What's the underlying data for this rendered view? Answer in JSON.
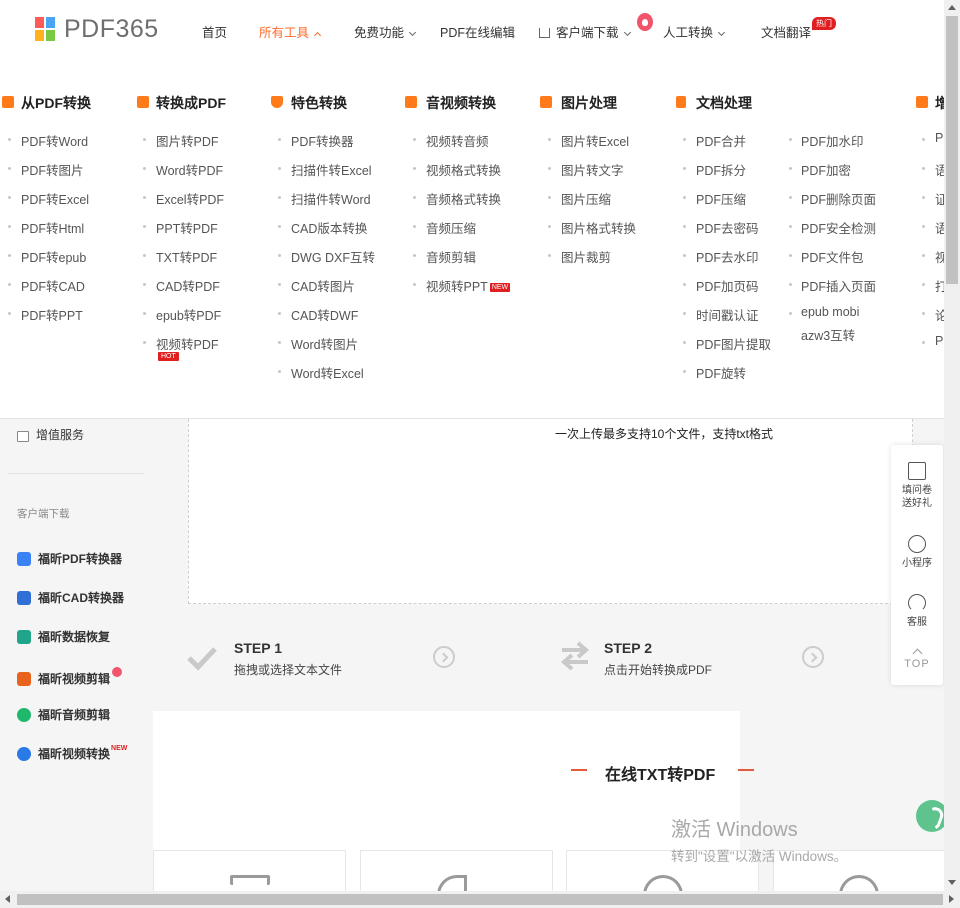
{
  "header": {
    "logo_text": "PDF365",
    "nav": [
      {
        "label": "首页"
      },
      {
        "label": "所有工具"
      },
      {
        "label": "免费功能"
      },
      {
        "label": "PDF在线编辑"
      },
      {
        "label": "客户端下载"
      },
      {
        "label": "人工转换"
      },
      {
        "label": "文档翻译"
      }
    ],
    "badge": "热门"
  },
  "mega_menu": {
    "columns": [
      {
        "title": "从PDF转换",
        "icon": "convert-from-pdf-icon",
        "items": [
          "PDF转Word",
          "PDF转图片",
          "PDF转Excel",
          "PDF转Html",
          "PDF转epub",
          "PDF转CAD",
          "PDF转PPT"
        ]
      },
      {
        "title": "转换成PDF",
        "icon": "convert-to-pdf-icon",
        "items": [
          "图片转PDF",
          "Word转PDF",
          "Excel转PDF",
          "PPT转PDF",
          "TXT转PDF",
          "CAD转PDF",
          "epub转PDF",
          "视频转PDF"
        ],
        "hot_tag": "HOT"
      },
      {
        "title": "特色转换",
        "icon": "shield-icon",
        "items": [
          "PDF转换器",
          "扫描件转Excel",
          "扫描件转Word",
          "CAD版本转换",
          "DWG DXF互转",
          "CAD转图片",
          "CAD转DWF",
          "Word转图片",
          "Word转Excel"
        ]
      },
      {
        "title": "音视频转换",
        "icon": "video-icon",
        "items": [
          "视频转音频",
          "视频格式转换",
          "音频格式转换",
          "音频压缩",
          "音频剪辑",
          "视频转PPT"
        ],
        "new_tag": "NEW"
      },
      {
        "title": "图片处理",
        "icon": "image-icon",
        "items": [
          "图片转Excel",
          "图片转文字",
          "图片压缩",
          "图片格式转换",
          "图片裁剪"
        ]
      },
      {
        "title": "文档处理",
        "icon": "document-icon",
        "items": [
          "PDF合并",
          "PDF拆分",
          "PDF压缩",
          "PDF去密码",
          "PDF去水印",
          "PDF加页码",
          "时间戳认证",
          "PDF图片提取",
          "PDF旋转"
        ]
      },
      {
        "title": "",
        "items": [
          "PDF加水印",
          "PDF加密",
          "PDF删除页面",
          "PDF安全检测",
          "PDF文件包",
          "PDF插入页面",
          "epub mobi",
          "azw3互转"
        ]
      },
      {
        "title": "增",
        "icon": "menu-icon",
        "items": [
          "P",
          "语",
          "证",
          "语",
          "视",
          "打",
          "论",
          "P"
        ]
      }
    ]
  },
  "sidebar": {
    "service_label": "增值服务",
    "section_label": "客户端下载",
    "apps": [
      {
        "label": "福昕PDF转换器",
        "color": "#3b82f6"
      },
      {
        "label": "福昕CAD转换器",
        "color": "#2f6fd6"
      },
      {
        "label": "福昕数据恢复",
        "color": "#1ea58a"
      },
      {
        "label": "福昕视频剪辑",
        "color": "#e8641c"
      },
      {
        "label": "福昕音频剪辑",
        "color": "#1fb86a"
      },
      {
        "label": "福昕视频转换",
        "color": "#2979e6"
      }
    ],
    "new_tag": "NEW"
  },
  "upload": {
    "hint": "一次上传最多支持10个文件，支持txt格式"
  },
  "steps": [
    {
      "title": "STEP 1",
      "subtitle": "拖拽或选择文本文件"
    },
    {
      "title": "STEP 2",
      "subtitle": "点击开始转换成PDF"
    }
  ],
  "section_title": "在线TXT转PDF",
  "floatbar": {
    "items": [
      {
        "label": "填问卷\n送好礼"
      },
      {
        "label": "小程序"
      },
      {
        "label": "客服"
      }
    ],
    "top_label": "TOP"
  },
  "watermark": {
    "line1": "激活 Windows",
    "line2": "转到\"设置\"以激活 Windows。"
  },
  "colors": {
    "accent": "#ff6c2c",
    "badge_red": "#e02020"
  }
}
